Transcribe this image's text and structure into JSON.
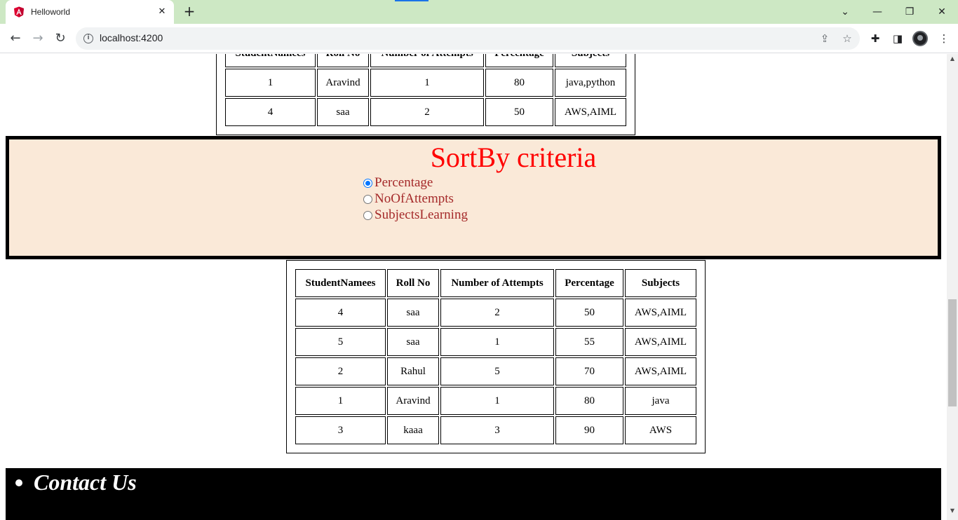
{
  "browser": {
    "tab_title": "Helloworld",
    "url": "localhost:4200"
  },
  "icons": {
    "tab_logo": "angular-logo-icon",
    "close": "close-icon",
    "new_tab": "plus-icon",
    "back": "arrow-left-icon",
    "forward": "arrow-right-icon",
    "reload": "reload-icon",
    "share": "share-icon",
    "bookmark": "star-icon",
    "extensions": "puzzle-icon",
    "side_panel": "side-panel-icon",
    "menu": "kebab-menu-icon"
  },
  "colors": {
    "tabstrip": "#cde8c4",
    "sort_panel_bg": "#fae9d8",
    "sort_title": "#ff0000",
    "radio_label": "#a52a2a"
  },
  "top_table": {
    "headers": [
      "StudentNamees",
      "Roll No",
      "Number of Attempts",
      "Percentage",
      "Subjects"
    ],
    "rows": [
      [
        "1",
        "Aravind",
        "1",
        "80",
        "java,python"
      ],
      [
        "4",
        "saa",
        "2",
        "50",
        "AWS,AIML"
      ]
    ]
  },
  "sort": {
    "title": "SortBy criteria",
    "options": [
      {
        "label": "Percentage",
        "checked": true
      },
      {
        "label": "NoOfAttempts",
        "checked": false
      },
      {
        "label": "SubjectsLearning",
        "checked": false
      }
    ]
  },
  "sorted_table": {
    "headers": [
      "StudentNamees",
      "Roll No",
      "Number of Attempts",
      "Percentage",
      "Subjects"
    ],
    "rows": [
      [
        "4",
        "saa",
        "2",
        "50",
        "AWS,AIML"
      ],
      [
        "5",
        "saa",
        "1",
        "55",
        "AWS,AIML"
      ],
      [
        "2",
        "Rahul",
        "5",
        "70",
        "AWS,AIML"
      ],
      [
        "1",
        "Aravind",
        "1",
        "80",
        "java"
      ],
      [
        "3",
        "kaaa",
        "3",
        "90",
        "AWS"
      ]
    ]
  },
  "footer": {
    "items": [
      "Contact Us"
    ]
  }
}
